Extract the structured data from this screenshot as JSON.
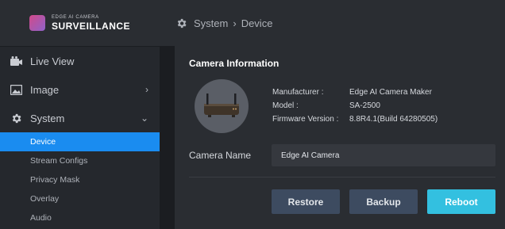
{
  "brand": {
    "sub": "EDGE AI CAMERA",
    "main": "SURVEILLANCE"
  },
  "sidebar": {
    "items": [
      {
        "label": "Live View",
        "icon": "video-icon"
      },
      {
        "label": "Image",
        "icon": "image-icon",
        "chevron": "›"
      },
      {
        "label": "System",
        "icon": "gear-icon",
        "chevron": "⌄"
      }
    ],
    "subitems": [
      "Device",
      "Stream Configs",
      "Privacy Mask",
      "Overlay",
      "Audio"
    ],
    "active_subitem": "Device"
  },
  "breadcrumb": {
    "parent": "System",
    "separator": "›",
    "current": "Device"
  },
  "panel": {
    "title": "Camera Information",
    "info": [
      {
        "label": "Manufacturer :",
        "value": "Edge AI Camera Maker"
      },
      {
        "label": "Model :",
        "value": "SA-2500"
      },
      {
        "label": "Firmware Version :",
        "value": "8.8R4.1(Build 64280505)"
      }
    ],
    "camera_name_label": "Camera Name",
    "camera_name_value": "Edge AI Camera",
    "buttons": {
      "restore": "Restore",
      "backup": "Backup",
      "reboot": "Reboot"
    }
  },
  "colors": {
    "accent": "#1a8cf0",
    "reboot": "#33c0e0",
    "secondary_button": "#3d4b60"
  }
}
